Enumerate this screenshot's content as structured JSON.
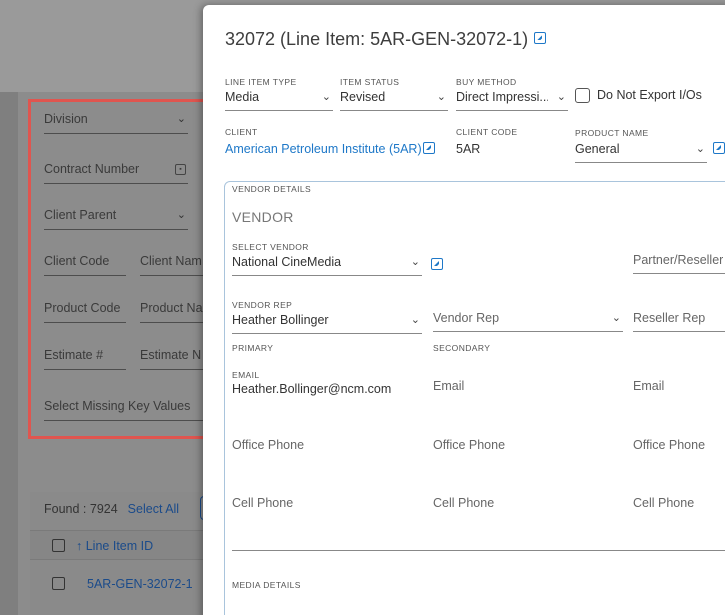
{
  "background": {
    "filters": {
      "division": "Division",
      "contract_number": "Contract Number",
      "client_parent": "Client Parent",
      "client_code": "Client Code",
      "client_name": "Client Nam",
      "product_code": "Product Code",
      "product_name": "Product Na",
      "estimate_no": "Estimate #",
      "estimate_name": "Estimate N",
      "missing_keys": "Select Missing Key Values"
    },
    "results": {
      "found": "Found : 7924",
      "select_all": "Select All",
      "column_header": "Line Item ID",
      "sort_icon": "↑",
      "rows": [
        "5AR-GEN-32072-1"
      ]
    }
  },
  "modal": {
    "title": "32072 (Line Item: 5AR-GEN-32072-1)",
    "line_item_type": {
      "label": "LINE ITEM TYPE",
      "value": "Media"
    },
    "item_status": {
      "label": "ITEM STATUS",
      "value": "Revised"
    },
    "buy_method": {
      "label": "BUY METHOD",
      "value": "Direct Impressi..."
    },
    "do_not_export": "Do Not Export I/Os",
    "client": {
      "label": "CLIENT",
      "value": "American Petroleum Institute (5AR)"
    },
    "client_code": {
      "label": "CLIENT CODE",
      "value": "5AR"
    },
    "product_name": {
      "label": "PRODUCT NAME",
      "value": "General"
    },
    "vendor_details": {
      "section_label": "VENDOR DETAILS",
      "vendor_heading": "VENDOR",
      "select_vendor": {
        "label": "SELECT VENDOR",
        "value": "National CineMedia"
      },
      "partner_reseller": "Partner/Reseller",
      "vendor_rep": {
        "label": "VENDOR REP",
        "value": "Heather Bollinger",
        "sublabel": "PRIMARY"
      },
      "secondary_rep": {
        "placeholder": "Vendor Rep",
        "sublabel": "SECONDARY"
      },
      "reseller_rep": {
        "placeholder": "Reseller Rep"
      },
      "primary_email": {
        "label": "EMAIL",
        "value": "Heather.Bollinger@ncm.com"
      },
      "secondary_email": "Email",
      "reseller_email": "Email",
      "office_phone": [
        "Office Phone",
        "Office Phone",
        "Office Phone"
      ],
      "cell_phone": [
        "Cell Phone",
        "Cell Phone",
        "Cell Phone"
      ]
    },
    "media_details": "MEDIA DETAILS"
  },
  "colors": {
    "link": "#1e78c8",
    "highlight": "#e0554f",
    "overlay": "#8c8c8c"
  }
}
